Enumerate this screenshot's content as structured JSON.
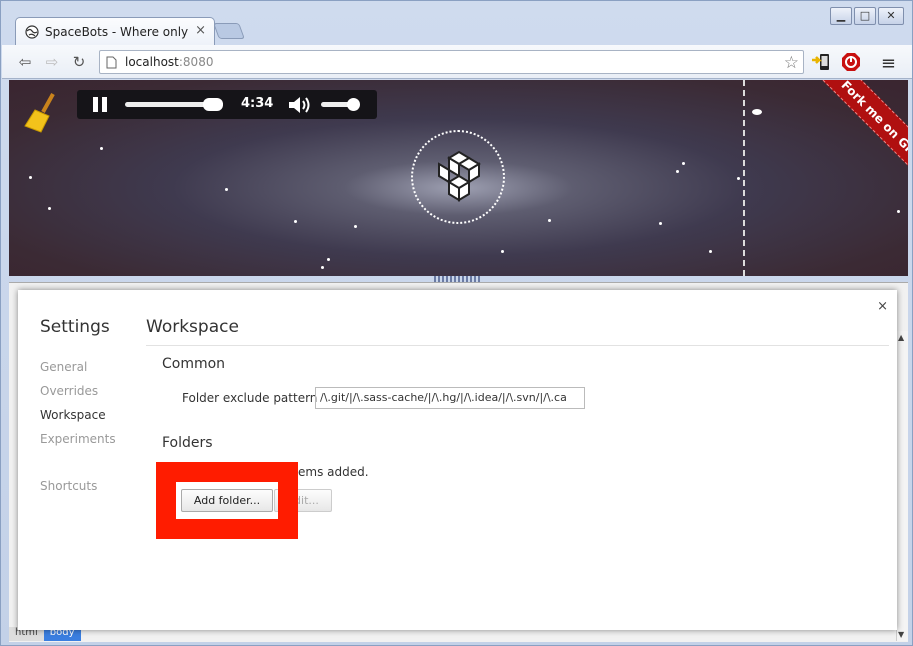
{
  "browser": {
    "tab_title": "SpaceBots - Where only li",
    "tab_close": "×",
    "url_host": "localhost",
    "url_port": ":8080",
    "win_min": "▁",
    "win_max": "□",
    "win_close": "✕",
    "back": "⇦",
    "forward": "⇨",
    "reload": "↻",
    "star": "☆",
    "menu": "≡"
  },
  "player": {
    "time": "4:34",
    "progress": 0.9,
    "volume": 0.85
  },
  "page": {
    "ribbon": "Fork me on GitHub"
  },
  "devtools": {
    "crumbs": [
      "html",
      "body"
    ]
  },
  "settings": {
    "heading": "Settings",
    "close": "×",
    "sidebar": [
      {
        "label": "General",
        "active": false
      },
      {
        "label": "Overrides",
        "active": false
      },
      {
        "label": "Workspace",
        "active": true
      },
      {
        "label": "Experiments",
        "active": false
      },
      {
        "label": "Shortcuts",
        "active": false
      }
    ],
    "panel_title": "Workspace",
    "common_title": "Common",
    "exclude_label": "Folder exclude pattern",
    "exclude_value": "/\\.git/|/\\.sass-cache/|/\\.hg/|/\\.idea/|/\\.svn/|/\\.ca",
    "folders_title": "Folders",
    "items_text": "ems added.",
    "add_folder": "Add folder...",
    "edit": "Edit..."
  },
  "colors": {
    "highlight": "#ff1c00",
    "ribbon": "#b01010"
  }
}
